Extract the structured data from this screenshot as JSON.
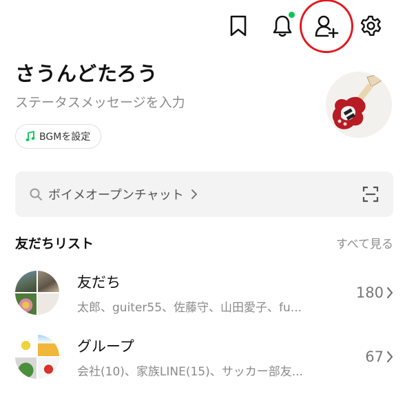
{
  "topbar": {
    "icons": [
      "bookmark-icon",
      "bell-icon",
      "add-friend-icon",
      "gear-icon"
    ],
    "notification_color": "#06c755",
    "highlight_color": "#e3171d"
  },
  "profile": {
    "name": "さうんどたろう",
    "status_placeholder": "ステータスメッセージを入力",
    "bgm_label": "BGMを設定",
    "avatar_icon": "electric-guitar-icon"
  },
  "search": {
    "label": "ボイメオープンチャット",
    "icon": "search-icon",
    "scan_icon": "scan-icon"
  },
  "friends_section": {
    "title": "友だちリスト",
    "see_all": "すべて見る",
    "rows": [
      {
        "title": "友だち",
        "subtitle": "太郎、guiter55、佐藤守、山田愛子、fu...",
        "count": "180"
      },
      {
        "title": "グループ",
        "subtitle": "会社(10)、家族LINE(15)、サッカー部友...",
        "count": "67"
      }
    ]
  },
  "colors": {
    "accent_green": "#06c755",
    "text_muted": "#8a8a8a",
    "search_bg": "#f3f3f4"
  }
}
